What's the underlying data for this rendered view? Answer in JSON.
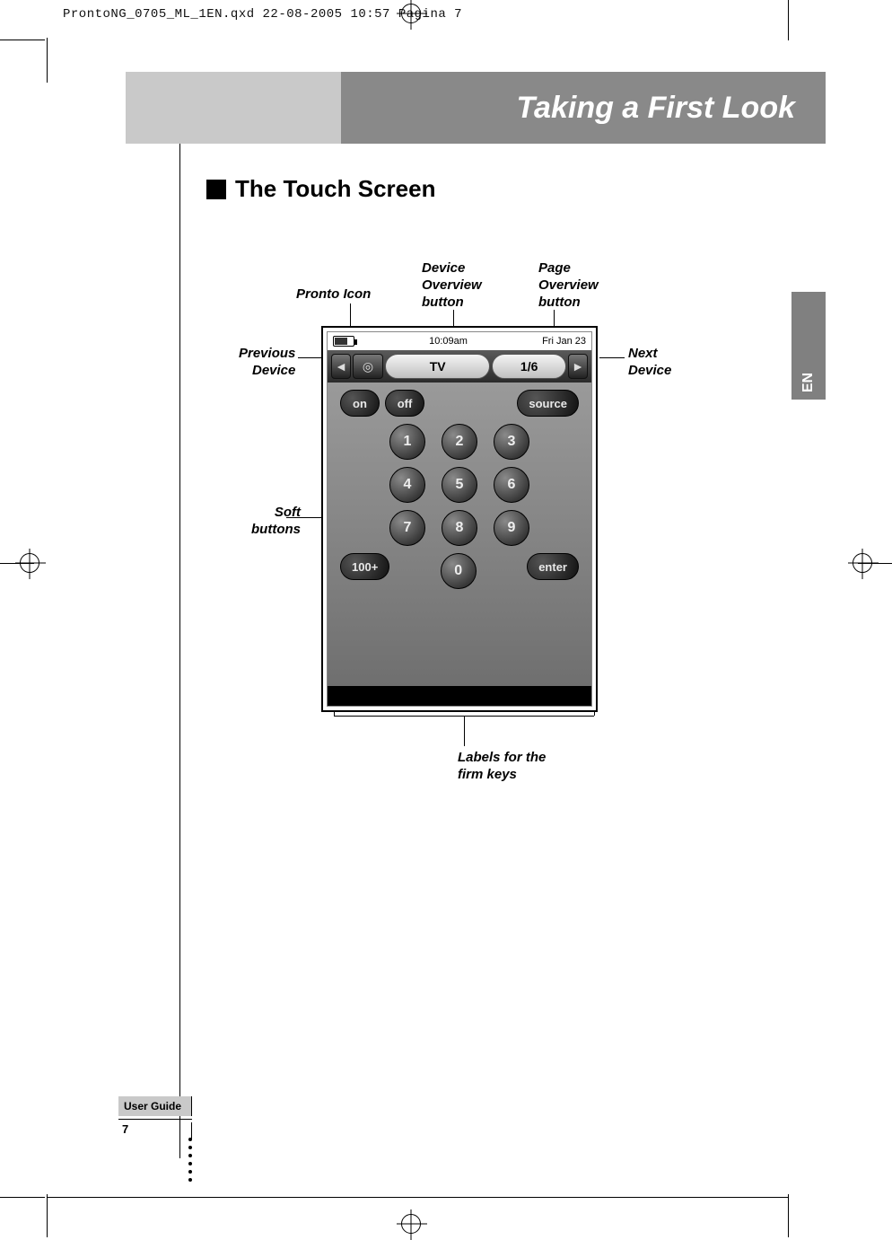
{
  "print_header": "ProntoNG_0705_ML_1EN.qxd  22-08-2005  10:57  Pagina 7",
  "chapter_title": "Taking a First Look",
  "lang_tab": "EN",
  "section_heading": "The Touch Screen",
  "callouts": {
    "pronto_icon": "Pronto Icon",
    "device_overview": "Device\nOverview\nbutton",
    "page_overview": "Page\nOverview\nbutton",
    "previous_device": "Previous\nDevice",
    "next_device": "Next\nDevice",
    "soft_buttons": "Soft\nbuttons",
    "firm_keys": "Labels for the\nfirm keys"
  },
  "screen": {
    "time": "10:09am",
    "date": "Fri Jan 23",
    "device_label": "TV",
    "page_label": "1/6",
    "buttons": {
      "on": "on",
      "off": "off",
      "source": "source",
      "hundred": "100+",
      "zero": "0",
      "enter": "enter",
      "n1": "1",
      "n2": "2",
      "n3": "3",
      "n4": "4",
      "n5": "5",
      "n6": "6",
      "n7": "7",
      "n8": "8",
      "n9": "9"
    }
  },
  "footer": {
    "user_guide": "User Guide",
    "page": "7"
  }
}
